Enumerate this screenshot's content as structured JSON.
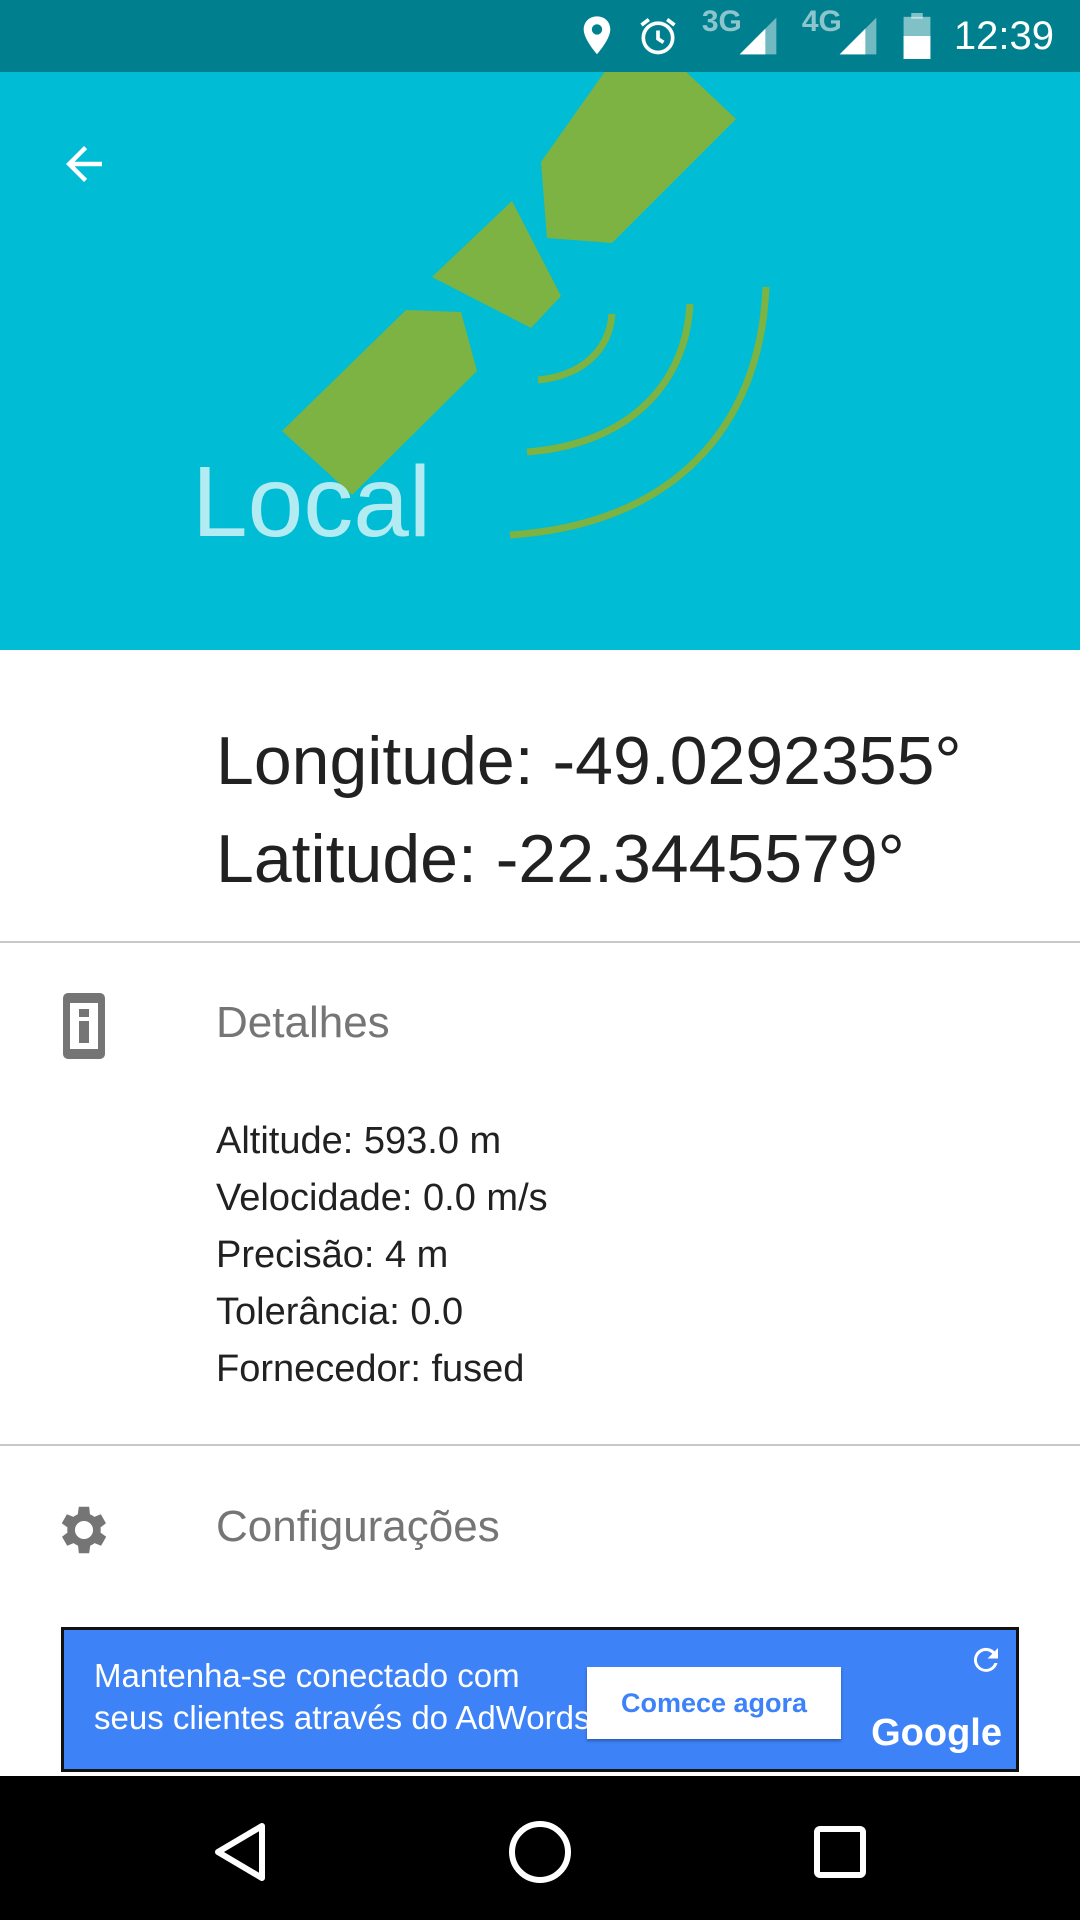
{
  "status_bar": {
    "time": "12:39",
    "network_1": "3G",
    "network_2": "4G",
    "icons": [
      "location-icon",
      "alarm-icon",
      "signal-3g-icon",
      "signal-4g-icon",
      "battery-icon"
    ]
  },
  "header": {
    "title": "Local",
    "background_color": "#00bcd4",
    "illustration_color": "#7cb342",
    "back_icon": "arrow-back-icon"
  },
  "coordinates": {
    "longitude": "Longitude: -49.0292355°",
    "latitude": "Latitude: -22.3445579°"
  },
  "details_section": {
    "title": "Detalhes",
    "icon": "info-icon",
    "lines": [
      "Altitude: 593.0 m",
      "Velocidade: 0.0 m/s",
      "Precisão: 4 m",
      "Tolerância: 0.0",
      "Fornecedor: fused"
    ]
  },
  "settings_section": {
    "title": "Configurações",
    "icon": "gear-icon"
  },
  "ad": {
    "text_line_1": "Mantenha-se conectado com",
    "text_line_2": "seus clientes através do AdWords.",
    "cta": "Comece agora",
    "brand": "Google",
    "background_color": "#3e82f7"
  },
  "nav_bar": {
    "icons": [
      "back-triangle-icon",
      "home-circle-icon",
      "recents-square-icon"
    ]
  }
}
